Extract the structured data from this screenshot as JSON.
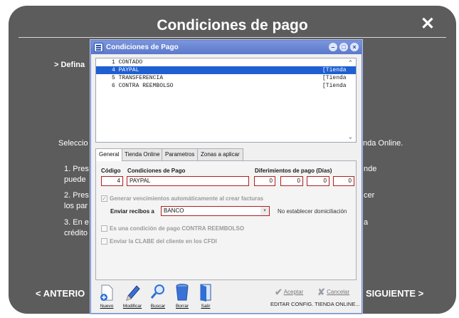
{
  "tutorial": {
    "title": "Condiciones de pago",
    "close_glyph": "✕",
    "define_text": "> Defina",
    "select_text": "Seleccio",
    "select_text_right": "nda Online.",
    "step1_a": "1. Pres",
    "step1_b": "puede",
    "step1_right": "nde",
    "step2_a": "2. Pres",
    "step2_b": "los par",
    "step2_right": "cer",
    "step3_a": "3. En e",
    "step3_b": "crédito",
    "step3_right": "a",
    "prev_label": "< ANTERIO",
    "next_label": "SIGUIENTE >"
  },
  "dialog": {
    "title": "Condiciones de Pago",
    "list": [
      {
        "text": "1 CONTADO",
        "tag": "",
        "selected": false
      },
      {
        "text": "4 PAYPAL",
        "tag": "[Tienda",
        "selected": true
      },
      {
        "text": "5 TRANSFERENCIA",
        "tag": "[Tienda",
        "selected": false
      },
      {
        "text": "6 CONTRA REEMBOLSO",
        "tag": "[Tienda",
        "selected": false
      }
    ],
    "tabs": [
      "General",
      "Tienda Online",
      "Parametros",
      "Zonas a aplicar"
    ],
    "active_tab": "General",
    "labels": {
      "codigo": "Código",
      "condiciones": "Condiciones de Pago",
      "diferimientos": "Diferimientos de pago (Días)",
      "generar": "Generar vencimientos automáticamente al crear facturas",
      "enviar": "Enviar recibos a",
      "no_domicilio": "No establecer domiciliación",
      "contra_reembolso": "Es una condición de pago CONTRA REEMBOLSO",
      "clabe": "Enviar la CLABE del cliente en los CFDI"
    },
    "values": {
      "codigo": "4",
      "condiciones": "PAYPAL",
      "dif1": "0",
      "dif2": "0",
      "dif3": "0",
      "dif4": "0",
      "enviar": "BANCO"
    },
    "checks": {
      "generar": true,
      "contra_reembolso": false,
      "clabe": false
    },
    "toolbar": {
      "nuevo": "Nuevo",
      "modificar": "Modificar",
      "buscar": "Buscar",
      "borrar": "Borrar",
      "salir": "Salir",
      "aceptar": "Aceptar",
      "cancelar": "Cancelar"
    },
    "status_text": "EDITAR CONFIG. TIENDA ONLINE...",
    "colors": {
      "selection": "#1e5fd2",
      "required_border": "#b02020",
      "titlebar": "#5b79cc"
    }
  }
}
